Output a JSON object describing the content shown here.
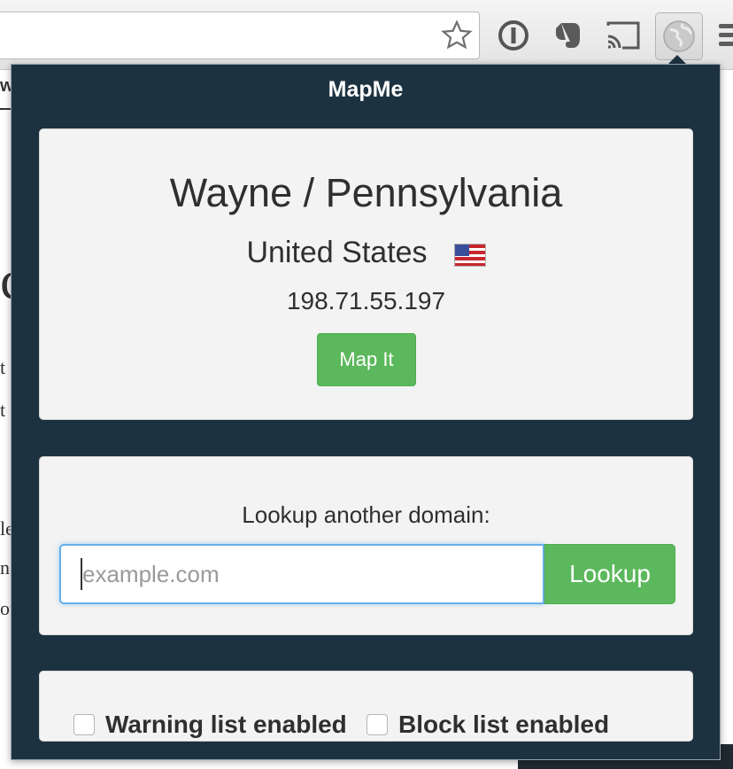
{
  "popup": {
    "title": "MapMe"
  },
  "location": {
    "city_region": "Wayne / Pennsylvania",
    "country": "United States",
    "ip": "198.71.55.197",
    "map_button": "Map It"
  },
  "lookup": {
    "label": "Lookup another domain:",
    "placeholder": "example.com",
    "button": "Lookup"
  },
  "options": {
    "warning_label": "Warning list enabled",
    "block_label": "Block list enabled"
  },
  "colors": {
    "popup_bg": "#1d3240",
    "card_bg": "#f3f3f3",
    "button_green": "#5cb85c",
    "input_focus": "#66afe9"
  },
  "toolbar_icons": [
    "star-icon",
    "onepassword-icon",
    "evernote-icon",
    "cast-icon",
    "mapme-globe-icon",
    "menu-icon"
  ],
  "background_page": {
    "fragment_a": "w",
    "fragment_b": "c:",
    "fragment_c": "t",
    "fragment_d": "t",
    "fragment_e": "le",
    "fragment_f": "n",
    "fragment_g": "ou"
  }
}
